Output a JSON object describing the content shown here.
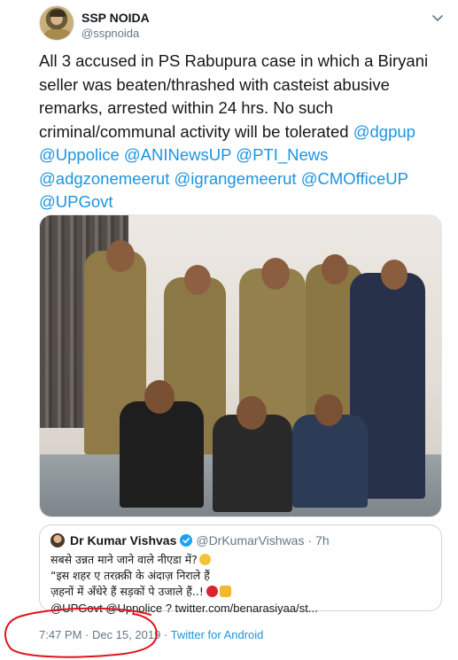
{
  "author": {
    "name": "SSP NOIDA",
    "handle": "@sspnoida",
    "avatar_icon": "profile-avatar"
  },
  "tweet": {
    "text_plain": "All 3 accused in PS Rabupura case in which a Biryani seller was beaten/thrashed with casteist abusive remarks, arrested within 24 hrs. No such criminal/communal activity will be tolerated ",
    "mentions": [
      "@dgpup",
      "@Uppolice",
      "@ANINewsUP",
      "@PTI_News",
      "@adgzonemeerut",
      "@igrangemeerut",
      "@CMOfficeUP",
      "@UPGovt"
    ]
  },
  "quoted": {
    "name": "Dr Kumar Vishvas",
    "handle": "@DrKumarVishwas",
    "time": "7h",
    "lines": [
      "सबसे उन्नत माने जाने वाले नीएडा में?",
      "“इस शहर ए तरक़्क़ी के अंदाज़ निराले हैं",
      "ज़हनों में अँधेरे हैं सड़कों पे उजाले हैं..!"
    ],
    "last_line": "@UPGovt @Uppolice ? twitter.com/benarasiyaa/st..."
  },
  "footer": {
    "time": "7:47 PM · Dec 15, 2019 ·",
    "source": "Twitter for Android"
  },
  "colors": {
    "link": "#1b95e0",
    "secondary_text": "#657786",
    "annotation": "#e0141b"
  }
}
